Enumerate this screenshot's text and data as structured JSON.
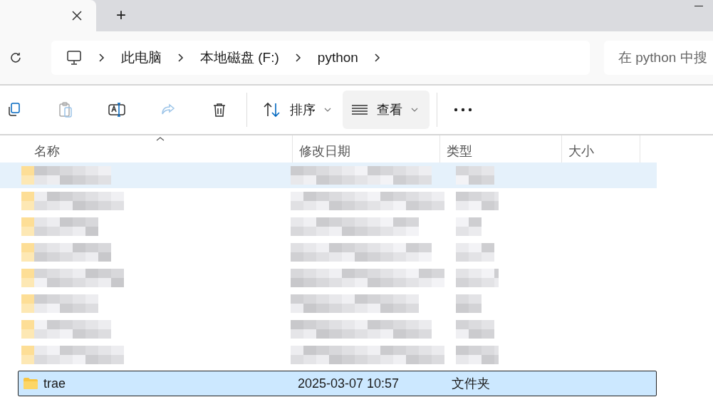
{
  "tabs": [
    {
      "kind": "tab",
      "selected": true
    },
    {
      "kind": "new",
      "label": "+"
    }
  ],
  "address": {
    "crumbs": [
      "此电脑",
      "本地磁盘 (F:)",
      "python"
    ]
  },
  "search": {
    "placeholder": "在 python 中搜"
  },
  "toolbar": {
    "sort": "排序",
    "view": "查看"
  },
  "table": {
    "columns": [
      "名称",
      "修改日期",
      "类型",
      "大小"
    ],
    "rows": [
      {
        "kind": "redacted",
        "hovered": true
      },
      {
        "kind": "redacted",
        "hovered": false
      },
      {
        "kind": "redacted",
        "hovered": false
      },
      {
        "kind": "redacted",
        "hovered": false
      },
      {
        "kind": "redacted",
        "hovered": false
      },
      {
        "kind": "redacted",
        "hovered": false
      },
      {
        "kind": "redacted",
        "hovered": false
      },
      {
        "kind": "redacted",
        "hovered": false
      },
      {
        "kind": "folder",
        "name": "trae",
        "modified": "2025-03-07 10:57",
        "type": "文件夹",
        "selected": true
      }
    ]
  }
}
